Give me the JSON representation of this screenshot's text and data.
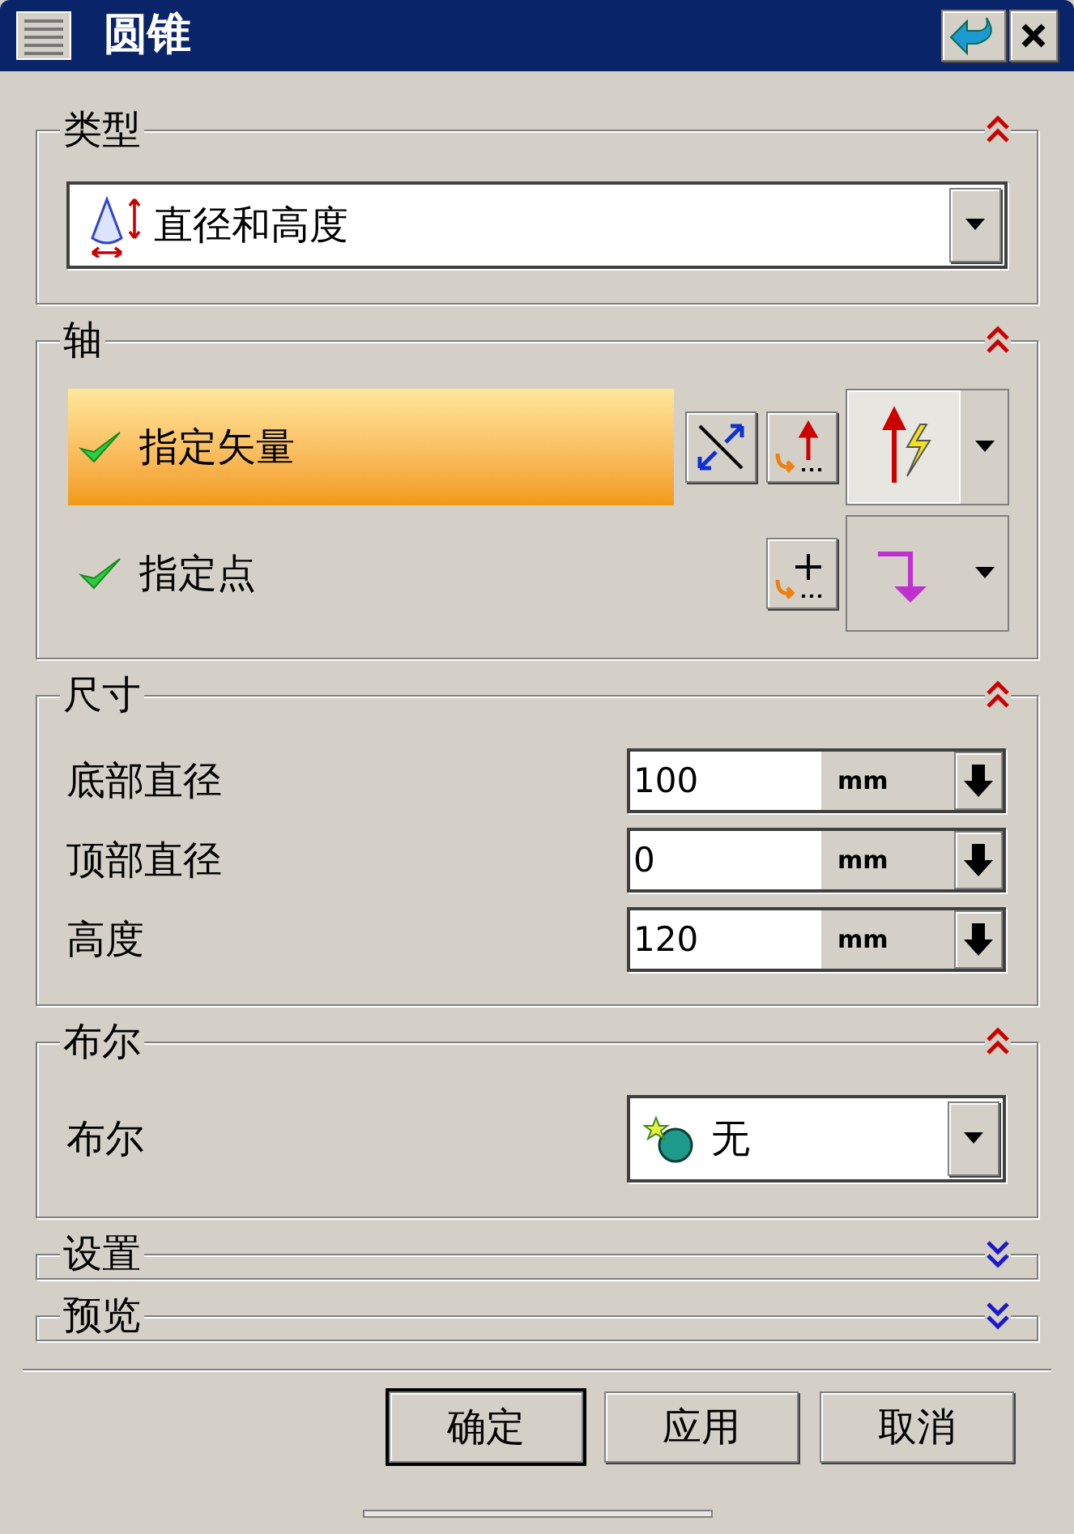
{
  "window": {
    "title": "圆锥"
  },
  "sections": [
    {
      "kind": "type",
      "title": "类型",
      "expanded": true,
      "dropdown": {
        "value": "直径和高度"
      }
    },
    {
      "kind": "axis",
      "title": "轴",
      "expanded": true,
      "rows": [
        {
          "label": "指定矢量",
          "checked": true,
          "selected": true
        },
        {
          "label": "指定点",
          "checked": true,
          "selected": false
        }
      ]
    },
    {
      "kind": "dimensions",
      "title": "尺寸",
      "expanded": true,
      "fields": [
        {
          "label": "底部直径",
          "value": "100",
          "unit": "mm"
        },
        {
          "label": "顶部直径",
          "value": "0",
          "unit": "mm"
        },
        {
          "label": "高度",
          "value": "120",
          "unit": "mm"
        }
      ]
    },
    {
      "kind": "boolean",
      "title": "布尔",
      "expanded": true,
      "label": "布尔",
      "dropdown": {
        "value": "无"
      }
    },
    {
      "title": "设置",
      "expanded": false
    },
    {
      "title": "预览",
      "expanded": false
    }
  ],
  "buttons": [
    {
      "label": "确定",
      "default": true
    },
    {
      "label": "应用",
      "default": false
    },
    {
      "label": "取消",
      "default": false
    }
  ]
}
